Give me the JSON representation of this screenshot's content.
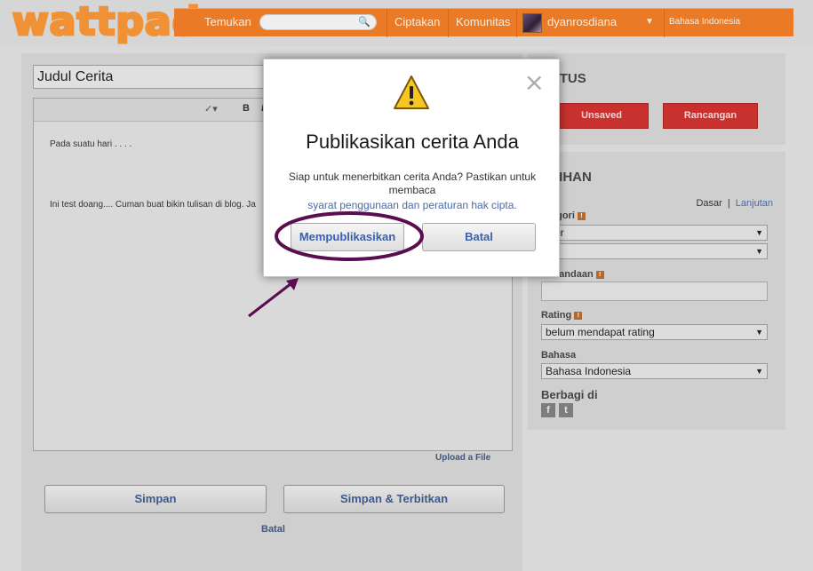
{
  "header": {
    "logo": "wattpad",
    "nav": {
      "discover": "Temukan",
      "create": "Ciptakan",
      "community": "Komunitas",
      "username": "dyanrosdiana",
      "language": "Bahasa Indonesia"
    }
  },
  "editor": {
    "title_value": "Judul Cerita",
    "toolbar": {
      "bold": "B",
      "italic": "I"
    },
    "lines": [
      "Pada suatu hari . . . .",
      "Ini test doang.... Cuman buat bikin tulisan di blog. Ja"
    ],
    "upload_link": "Upload a File",
    "save_button": "Simpan",
    "save_publish_button": "Simpan & Terbitkan",
    "cancel_link": "Batal"
  },
  "status_panel": {
    "heading": "ATUS",
    "unsaved_button": "Unsaved",
    "draft_button": "Rancangan"
  },
  "options_panel": {
    "heading": "LIHAN",
    "basic_link": "Dasar",
    "separator": "|",
    "advanced_link": "Lanjutan",
    "category_label": "egori",
    "category_value": "mor",
    "tags_label": "Penandaan",
    "rating_label": "Rating",
    "rating_value": "belum mendapat rating",
    "language_label": "Bahasa",
    "language_value": "Bahasa Indonesia",
    "share_label": "Berbagi di",
    "info_badge": "!",
    "social": {
      "facebook": "f",
      "twitter": "t"
    }
  },
  "modal": {
    "title": "Publikasikan cerita Anda",
    "message": "Siap untuk menerbitkan cerita Anda? Pastikan untuk membaca",
    "terms_link": "syarat penggunaan dan peraturan hak cipta.",
    "publish_button": "Mempublikasikan",
    "cancel_button": "Batal",
    "close": "×"
  },
  "colors": {
    "nav_orange": "#ea7a25",
    "logo_orange": "#f19136",
    "red_button": "#c9312f",
    "link_blue": "#4a6aa8",
    "annotation_purple": "#5a0d4f",
    "warning_yellow": "#f6c623"
  },
  "icons": {
    "search": "search-icon",
    "warning": "warning-icon",
    "close": "close-icon",
    "caret": "chevron-down-icon"
  }
}
